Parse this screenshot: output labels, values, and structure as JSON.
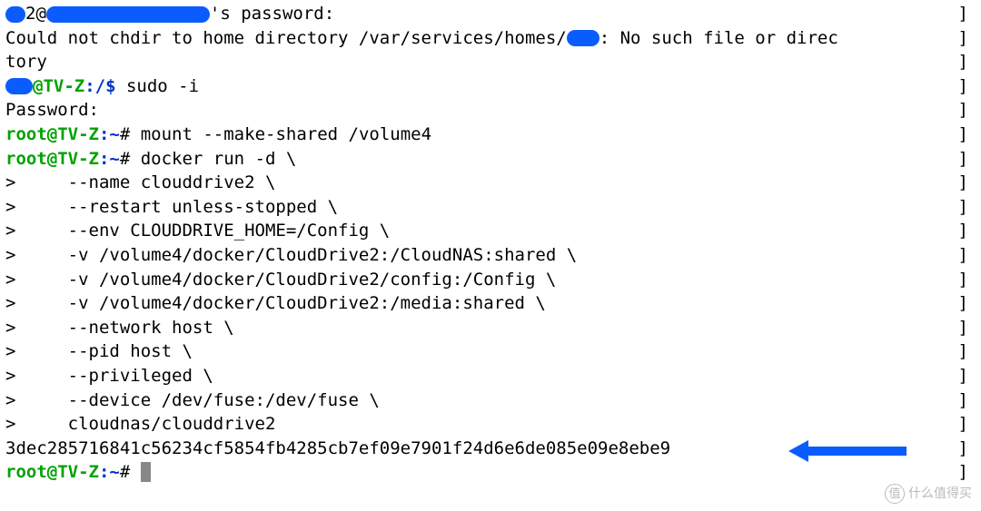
{
  "lines": {
    "l1_a": "2@",
    "l1_b": "'s password:",
    "l2": "Could not chdir to home directory /var/services/homes/",
    "l2b": ": No such file or direc",
    "l3": "tory",
    "l4_user": "@TV-Z",
    "l4_path": ":/$",
    "l4_cmd": " sudo -i",
    "l5": "Password:",
    "l6_user": "root@TV-Z",
    "l6_path": ":~",
    "l6_hash": "#",
    "l6_cmd": " mount --make-shared /volume4",
    "l7_cmd": " docker run -d \\",
    "l8": ">     --name clouddrive2 \\",
    "l9": ">     --restart unless-stopped \\",
    "l10": ">     --env CLOUDDRIVE_HOME=/Config \\",
    "l11": ">     -v /volume4/docker/CloudDrive2:/CloudNAS:shared \\",
    "l12": ">     -v /volume4/docker/CloudDrive2/config:/Config \\",
    "l13": ">     -v /volume4/docker/CloudDrive2:/media:shared \\",
    "l14": ">     --network host \\",
    "l15": ">     --pid host \\",
    "l16": ">     --privileged \\",
    "l17": ">     --device /dev/fuse:/dev/fuse \\",
    "l18": ">     cloudnas/clouddrive2",
    "l19": "3dec285716841c56234cf5854fb4285cb7ef09e7901f24d6e6de085e09e8ebe9",
    "bracket": "]"
  },
  "watermark": "什么值得买",
  "watermark_logo": "值"
}
